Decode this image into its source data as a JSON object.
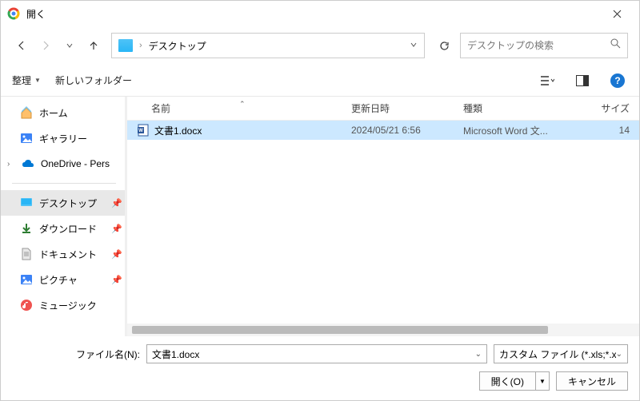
{
  "title": "開く",
  "breadcrumb": {
    "location": "デスクトップ"
  },
  "search": {
    "placeholder": "デスクトップの検索"
  },
  "toolbar": {
    "organize": "整理",
    "newFolder": "新しいフォルダー"
  },
  "sidebar": {
    "home": "ホーム",
    "gallery": "ギャラリー",
    "onedrive": "OneDrive - Pers",
    "desktop": "デスクトップ",
    "downloads": "ダウンロード",
    "documents": "ドキュメント",
    "pictures": "ピクチャ",
    "music": "ミュージック"
  },
  "columns": {
    "name": "名前",
    "date": "更新日時",
    "type": "種類",
    "size": "サイズ"
  },
  "files": [
    {
      "name": "文書1.docx",
      "date": "2024/05/21 6:56",
      "type": "Microsoft Word 文...",
      "size": "14"
    }
  ],
  "footer": {
    "filenameLabel": "ファイル名(N):",
    "filenameValue": "文書1.docx",
    "filter": "カスタム ファイル (*.xls;*.xlsx;*.xlb;*.",
    "open": "開く(O)",
    "cancel": "キャンセル"
  }
}
